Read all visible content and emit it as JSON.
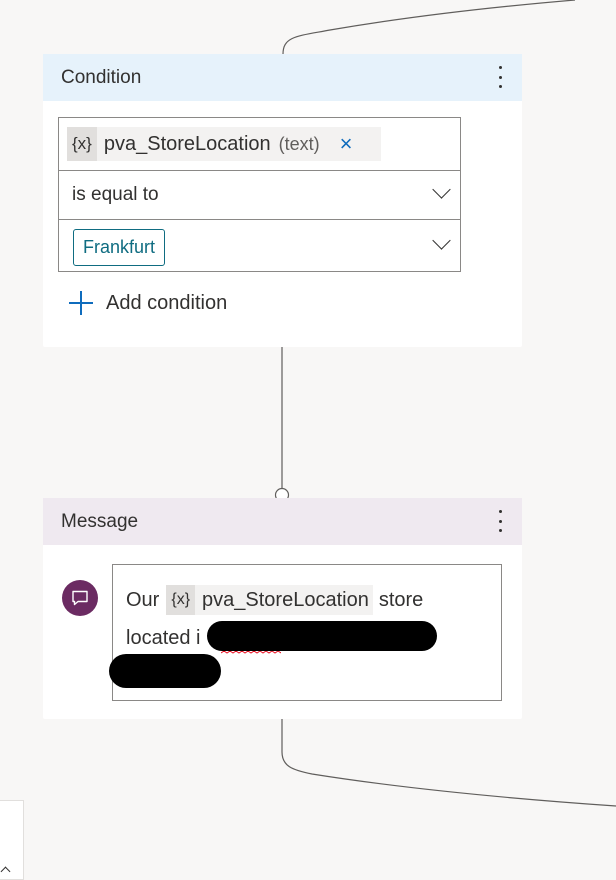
{
  "condition": {
    "title": "Condition",
    "variable": {
      "prefix": "{x}",
      "name": "pva_StoreLocation",
      "type": "(text)",
      "remove": "×"
    },
    "operator": "is equal to",
    "value": "Frankfurt",
    "add_label": "Add condition"
  },
  "message": {
    "title": "Message",
    "text_before": "Our",
    "variable_prefix": "{x}",
    "variable_name": "pva_StoreLocation",
    "text_after": "store",
    "line2": "located i"
  },
  "colors": {
    "condition_header": "#e6f2fb",
    "message_header": "#efe9f0",
    "accent": "#0f6cbd",
    "value_tag": "#0f6c81",
    "message_icon": "#6b2b62",
    "canvas": "#f8f7f6"
  },
  "icons": [
    "more-vertical-icon",
    "close-icon",
    "chevron-down-icon",
    "add-icon",
    "chat-message-icon",
    "chevron-up-icon"
  ]
}
